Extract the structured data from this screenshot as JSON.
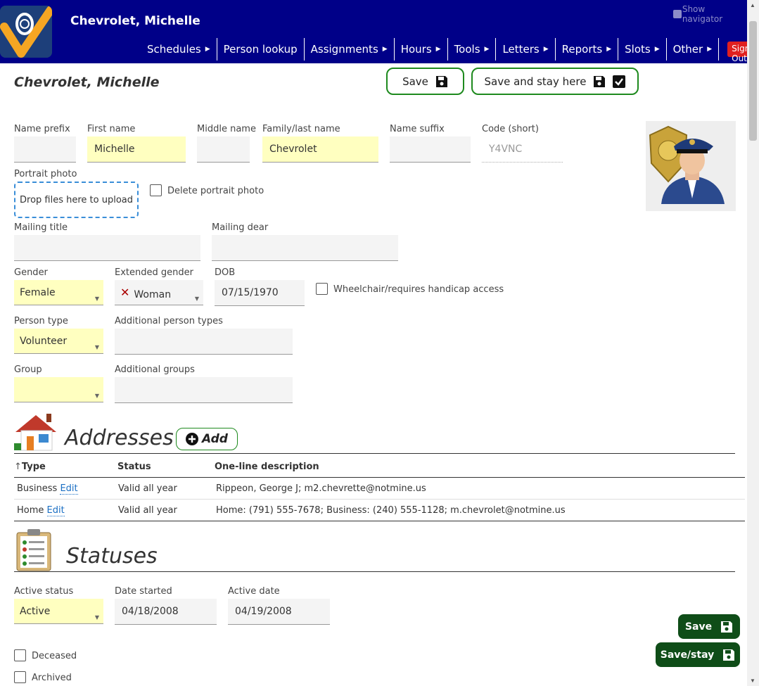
{
  "header": {
    "title": "Chevrolet, Michelle",
    "show_navigator": "Show navigator",
    "menu": [
      {
        "label": "Schedules",
        "arrow": "▶"
      },
      {
        "label": "Person lookup",
        "arrow": ""
      },
      {
        "label": "Assignments",
        "arrow": "▶"
      },
      {
        "label": "Hours",
        "arrow": "▶"
      },
      {
        "label": "Tools",
        "arrow": "▶"
      },
      {
        "label": "Letters",
        "arrow": "▶"
      },
      {
        "label": "Reports",
        "arrow": "▶"
      },
      {
        "label": "Slots",
        "arrow": "▶"
      },
      {
        "label": "Other",
        "arrow": "▶"
      }
    ],
    "sign_out": "Sign Out"
  },
  "page": {
    "title": "Chevrolet, Michelle",
    "save_label": "Save",
    "save_stay_label": "Save and stay here"
  },
  "name_fields": {
    "prefix": {
      "label": "Name prefix",
      "value": ""
    },
    "first": {
      "label": "First name",
      "value": "Michelle"
    },
    "middle": {
      "label": "Middle name",
      "value": ""
    },
    "last": {
      "label": "Family/last name",
      "value": "Chevrolet"
    },
    "suffix": {
      "label": "Name suffix",
      "value": ""
    },
    "code": {
      "label": "Code (short)",
      "value": "Y4VNC"
    }
  },
  "portrait": {
    "label": "Portrait photo",
    "upload_text": "Drop files here to upload",
    "delete_label": "Delete portrait photo"
  },
  "mailing": {
    "title_label": "Mailing title",
    "title_value": "",
    "dear_label": "Mailing dear",
    "dear_value": ""
  },
  "demographics": {
    "gender_label": "Gender",
    "gender_value": "Female",
    "ext_gender_label": "Extended gender",
    "ext_gender_value": "Woman",
    "dob_label": "DOB",
    "dob_value": "07/15/1970",
    "wheelchair_label": "Wheelchair/requires handicap access"
  },
  "types": {
    "person_type_label": "Person type",
    "person_type_value": "Volunteer",
    "additional_types_label": "Additional person types",
    "group_label": "Group",
    "group_value": "",
    "additional_groups_label": "Additional groups"
  },
  "addresses": {
    "title": "Addresses",
    "add_label": "Add",
    "columns": [
      "Type",
      "Status",
      "One-line description"
    ],
    "rows": [
      {
        "type": "Business",
        "edit": "Edit",
        "status": "Valid all year",
        "desc": "Rippeon, George J; m2.chevrette@notmine.us"
      },
      {
        "type": "Home",
        "edit": "Edit",
        "status": "Valid all year",
        "desc": "Home: (791) 555-7678; Business: (240) 555-1128; m.chevrolet@notmine.us"
      }
    ]
  },
  "statuses": {
    "title": "Statuses",
    "active_status_label": "Active status",
    "active_status_value": "Active",
    "date_started_label": "Date started",
    "date_started_value": "04/18/2008",
    "active_date_label": "Active date",
    "active_date_value": "04/19/2008",
    "deceased_label": "Deceased",
    "archived_label": "Archived"
  },
  "footer_buttons": {
    "save": "Save",
    "save_stay": "Save/stay"
  },
  "colors": {
    "header_bg": "#000088",
    "required_bg": "#ffffc0",
    "accent_green": "#1e8a1e",
    "dark_green": "#0f4d18",
    "sign_out_red": "#e02020"
  }
}
